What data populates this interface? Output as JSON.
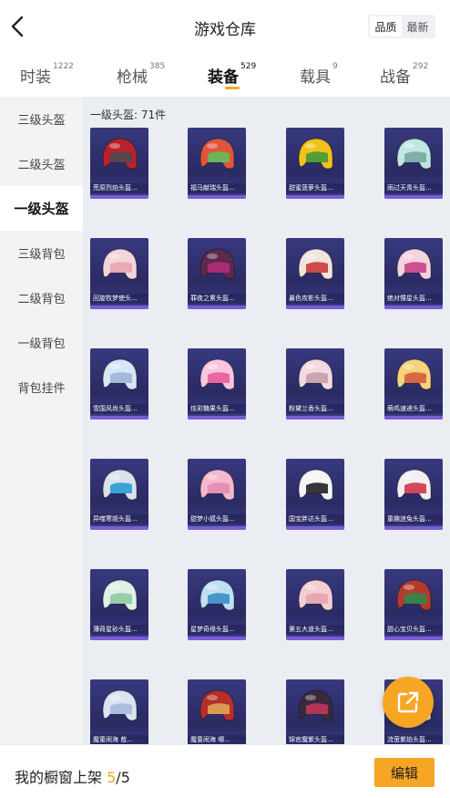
{
  "header": {
    "title": "游戏仓库",
    "sort_options": [
      "品质",
      "最新"
    ],
    "sort_selected": 0
  },
  "tabs": [
    {
      "label": "时装",
      "count": "1222"
    },
    {
      "label": "枪械",
      "count": "385"
    },
    {
      "label": "装备",
      "count": "529"
    },
    {
      "label": "载具",
      "count": "9"
    },
    {
      "label": "战备",
      "count": "292"
    }
  ],
  "active_tab": 2,
  "sidebar": {
    "items": [
      "三级头盔",
      "二级头盔",
      "一级头盔",
      "三级背包",
      "二级背包",
      "一级背包",
      "背包挂件"
    ],
    "active": 2
  },
  "section": {
    "title": "一级头盔: 71件"
  },
  "items": [
    {
      "name": "荒原烈焰头盔...",
      "color": "#b8232b",
      "accent": "#4a4a52"
    },
    {
      "name": "福马献瑞头盔...",
      "color": "#e0553a",
      "accent": "#5fbf5a"
    },
    {
      "name": "甜蜜菠萝头盔...",
      "color": "#f2c21a",
      "accent": "#3e9b3a"
    },
    {
      "name": "雨过天青头盔...",
      "color": "#bfe6e0",
      "accent": "#79a8a3"
    },
    {
      "name": "回旋牧梦使头...",
      "color": "#f3d6da",
      "accent": "#e8a5b0"
    },
    {
      "name": "罪夜之累头盔...",
      "color": "#5c2a4a",
      "accent": "#b12a7a"
    },
    {
      "name": "暴色攻影头盔...",
      "color": "#f0e4dc",
      "accent": "#c93a3a"
    },
    {
      "name": "绝对憧星头盔...",
      "color": "#f4d2de",
      "accent": "#c8418a"
    },
    {
      "name": "雪国风尚头盔...",
      "color": "#d9e6f5",
      "accent": "#9fb4d6"
    },
    {
      "name": "炫彩糖果头盔...",
      "color": "#f7c6dc",
      "accent": "#e95a9b"
    },
    {
      "name": "粉黛兰香头盔...",
      "color": "#f1dbe0",
      "accent": "#c7a0aa"
    },
    {
      "name": "萌鸡速递头盔...",
      "color": "#f6d27a",
      "accent": "#d65c3a"
    },
    {
      "name": "异噬寒姬头盔...",
      "color": "#d9e3ea",
      "accent": "#2a9bd6"
    },
    {
      "name": "甜梦小狐头盔...",
      "color": "#f4b8cc",
      "accent": "#e58ab0"
    },
    {
      "name": "国宝胖达头盔...",
      "color": "#f5f5f5",
      "accent": "#222222"
    },
    {
      "name": "童趣迷兔头盔...",
      "color": "#f3eef0",
      "accent": "#d0354a"
    },
    {
      "name": "薄荷星砂头盔...",
      "color": "#dff0e4",
      "accent": "#8fcaa0"
    },
    {
      "name": "星梦奇缘头盔...",
      "color": "#bfe0f2",
      "accent": "#3a8fc6"
    },
    {
      "name": "第五大道头盔...",
      "color": "#f4cdd3",
      "accent": "#e3a5ae"
    },
    {
      "name": "甜心宝贝头盔...",
      "color": "#b43a2e",
      "accent": "#2b8a4a"
    },
    {
      "name": "魔童闹海 敖...",
      "color": "#dbe4f2",
      "accent": "#a6b8de"
    },
    {
      "name": "魔童闹海 哪...",
      "color": "#b53028",
      "accent": "#e0a45a"
    },
    {
      "name": "锦官魔紫头盔...",
      "color": "#3a2a3e",
      "accent": "#c2375a"
    },
    {
      "name": "流萤紫焰头盔...",
      "color": "#f1d7c2",
      "accent": "#b14a8a"
    }
  ],
  "bottom": {
    "label": "我的橱窗上架",
    "current": "5",
    "total": "/5",
    "edit_label": "编辑"
  },
  "icons": {
    "back": "chevron-left-icon",
    "share": "share-icon"
  },
  "colors": {
    "accent": "#f5a623",
    "card_bg": "#2a2b63",
    "card_strip": "#7a5cd6"
  }
}
